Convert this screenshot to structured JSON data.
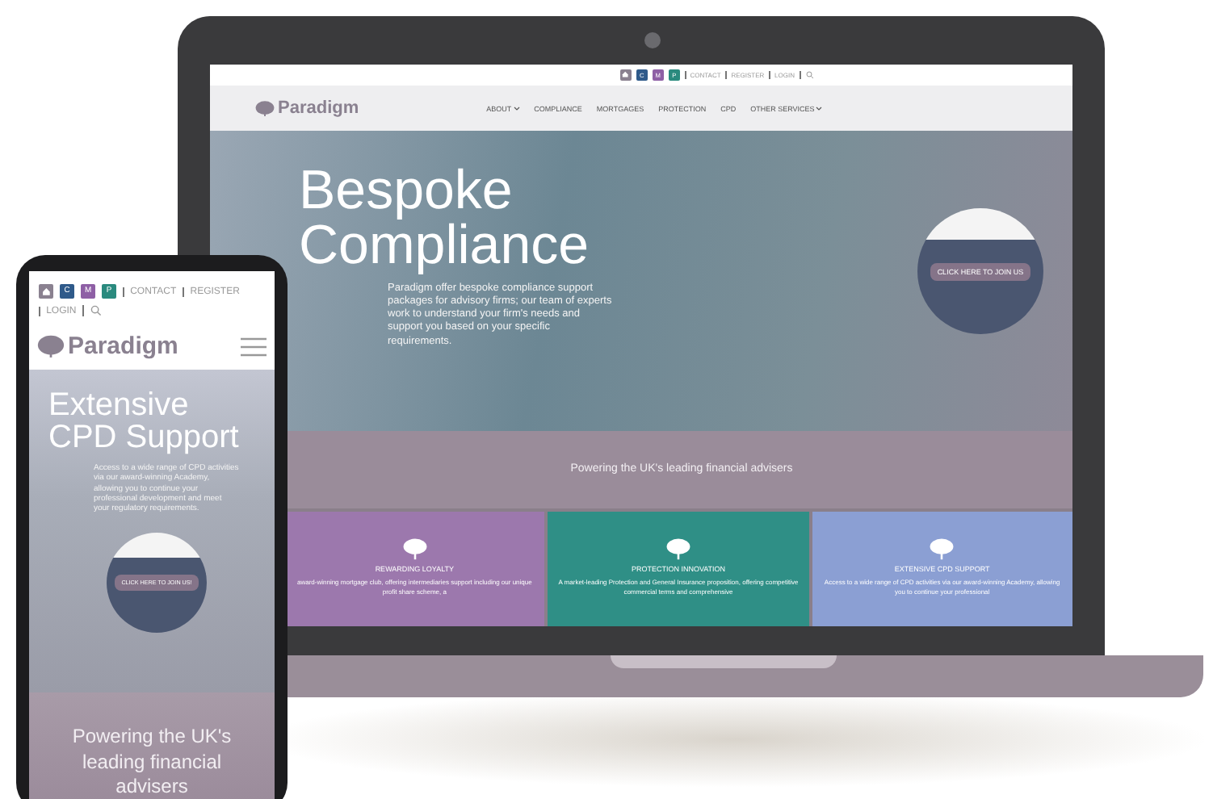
{
  "laptop": {
    "topbar": {
      "brand_buttons": [
        {
          "kind": "home",
          "color": "#8a8190"
        },
        {
          "kind": "letter",
          "label": "C",
          "color": "#2f5a8a"
        },
        {
          "kind": "letter",
          "label": "M",
          "color": "#8e5fa5"
        },
        {
          "kind": "letter",
          "label": "P",
          "color": "#2a8a7e"
        }
      ],
      "links": [
        "CONTACT",
        "REGISTER",
        "LOGIN"
      ]
    },
    "logo": "Paradigm",
    "nav": [
      {
        "label": "ABOUT",
        "dropdown": true
      },
      {
        "label": "COMPLIANCE",
        "dropdown": false
      },
      {
        "label": "MORTGAGES",
        "dropdown": false
      },
      {
        "label": "PROTECTION",
        "dropdown": false
      },
      {
        "label": "CPD",
        "dropdown": false
      },
      {
        "label": "OTHER SERVICES",
        "dropdown": true
      }
    ],
    "hero": {
      "title": "Bespoke Compliance",
      "text": "Paradigm offer bespoke compliance support packages for advisory firms; our team of experts work to understand your firm's needs and support you based on your specific requirements.",
      "join_button": "CLICK HERE TO JOIN US"
    },
    "tagline": "Powering the UK's leading financial advisers",
    "cards": [
      {
        "title": "REWARDING LOYALTY",
        "text": "award-winning mortgage club, offering intermediaries support including our unique profit share scheme, a",
        "color": "#9c78ad"
      },
      {
        "title": "PROTECTION INNOVATION",
        "text": "A market-leading Protection and General Insurance proposition, offering competitive commercial terms and comprehensive",
        "color": "#2f8f86"
      },
      {
        "title": "EXTENSIVE CPD SUPPORT",
        "text": "Access to a wide range of CPD activities via our award-winning Academy, allowing you to continue your professional",
        "color": "#8b9fd3"
      }
    ]
  },
  "phone": {
    "topbar": {
      "brand_buttons": [
        {
          "kind": "home",
          "color": "#8a8190"
        },
        {
          "kind": "letter",
          "label": "C",
          "color": "#2f5a8a"
        },
        {
          "kind": "letter",
          "label": "M",
          "color": "#8e5fa5"
        },
        {
          "kind": "letter",
          "label": "P",
          "color": "#2a8a7e"
        }
      ],
      "links": [
        "CONTACT",
        "REGISTER",
        "LOGIN"
      ]
    },
    "logo": "Paradigm",
    "hero": {
      "title": "Extensive CPD Support",
      "text": "Access to a wide range of CPD activities via our award-winning Academy, allowing you to continue your professional development and meet your regulatory requirements.",
      "join_button": "CLICK HERE TO JOIN US!"
    },
    "tagline": "Powering the UK's leading financial advisers"
  }
}
